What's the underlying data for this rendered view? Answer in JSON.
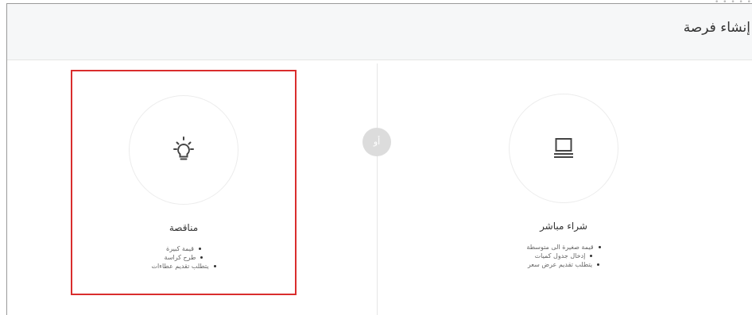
{
  "header": {
    "title": "إنشاء فرصة"
  },
  "top_dots": "• • • • •",
  "separator": {
    "label": "أو"
  },
  "cards": [
    {
      "id": "direct-purchase",
      "title": "شراء مباشر",
      "icon": "laptop-icon",
      "bullets": [
        "قيمة صغيرة الى متوسطة",
        "إدخال جدول كميات",
        "يتطلب تقديم عرض سعر"
      ]
    },
    {
      "id": "tender",
      "title": "مناقصة",
      "icon": "lightbulb-icon",
      "selected": true,
      "bullets": [
        "قيمة كبيرة",
        "طرح كراسة",
        "يتطلب تقديم عطاءات"
      ]
    }
  ],
  "colors": {
    "selected_border": "#d92d2d",
    "header_bg": "#f6f7f8",
    "separator_bg": "#dcdcdc"
  }
}
